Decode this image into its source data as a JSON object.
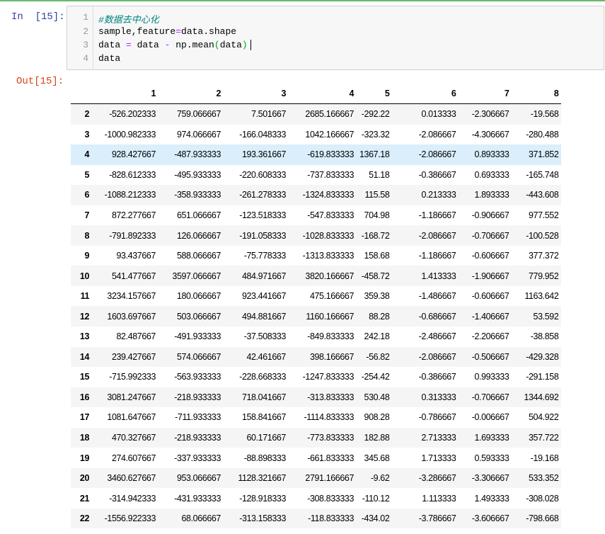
{
  "cell": {
    "in_prompt": "In  [15]:",
    "out_prompt": "Out[15]:",
    "line_numbers": [
      "1",
      "2",
      "3",
      "4"
    ],
    "code": {
      "line1_comment": "#数据去中心化",
      "line2_a": "sample,feature",
      "line2_op": "=",
      "line2_b": "data.shape",
      "line3_a": "data ",
      "line3_op1": "=",
      "line3_b": " data ",
      "line3_op2": "-",
      "line3_c": " np.mean",
      "line3_p1": "(",
      "line3_d": "data",
      "line3_p2": ")",
      "line4": "data"
    }
  },
  "table": {
    "columns": [
      "1",
      "2",
      "3",
      "4",
      "5",
      "6",
      "7",
      "8"
    ],
    "highlighted_row": "4",
    "rows": [
      {
        "index": "2",
        "values": [
          "-526.202333",
          "759.066667",
          "7.501667",
          "2685.166667",
          "-292.22",
          "0.013333",
          "-2.306667",
          "-19.568"
        ]
      },
      {
        "index": "3",
        "values": [
          "-1000.982333",
          "974.066667",
          "-166.048333",
          "1042.166667",
          "-323.32",
          "-2.086667",
          "-4.306667",
          "-280.488"
        ]
      },
      {
        "index": "4",
        "values": [
          "928.427667",
          "-487.933333",
          "193.361667",
          "-619.833333",
          "1367.18",
          "-2.086667",
          "0.893333",
          "371.852"
        ]
      },
      {
        "index": "5",
        "values": [
          "-828.612333",
          "-495.933333",
          "-220.608333",
          "-737.833333",
          "51.18",
          "-0.386667",
          "0.693333",
          "-165.748"
        ]
      },
      {
        "index": "6",
        "values": [
          "-1088.212333",
          "-358.933333",
          "-261.278333",
          "-1324.833333",
          "115.58",
          "0.213333",
          "1.893333",
          "-443.608"
        ]
      },
      {
        "index": "7",
        "values": [
          "872.277667",
          "651.066667",
          "-123.518333",
          "-547.833333",
          "704.98",
          "-1.186667",
          "-0.906667",
          "977.552"
        ]
      },
      {
        "index": "8",
        "values": [
          "-791.892333",
          "126.066667",
          "-191.058333",
          "-1028.833333",
          "-168.72",
          "-2.086667",
          "-0.706667",
          "-100.528"
        ]
      },
      {
        "index": "9",
        "values": [
          "93.437667",
          "588.066667",
          "-75.778333",
          "-1313.833333",
          "158.68",
          "-1.186667",
          "-0.606667",
          "377.372"
        ]
      },
      {
        "index": "10",
        "values": [
          "541.477667",
          "3597.066667",
          "484.971667",
          "3820.166667",
          "-458.72",
          "1.413333",
          "-1.906667",
          "779.952"
        ]
      },
      {
        "index": "11",
        "values": [
          "3234.157667",
          "180.066667",
          "923.441667",
          "475.166667",
          "359.38",
          "-1.486667",
          "-0.606667",
          "1163.642"
        ]
      },
      {
        "index": "12",
        "values": [
          "1603.697667",
          "503.066667",
          "494.881667",
          "1160.166667",
          "88.28",
          "-0.686667",
          "-1.406667",
          "53.592"
        ]
      },
      {
        "index": "13",
        "values": [
          "82.487667",
          "-491.933333",
          "-37.508333",
          "-849.833333",
          "242.18",
          "-2.486667",
          "-2.206667",
          "-38.858"
        ]
      },
      {
        "index": "14",
        "values": [
          "239.427667",
          "574.066667",
          "42.461667",
          "398.166667",
          "-56.82",
          "-2.086667",
          "-0.506667",
          "-429.328"
        ]
      },
      {
        "index": "15",
        "values": [
          "-715.992333",
          "-563.933333",
          "-228.668333",
          "-1247.833333",
          "-254.42",
          "-0.386667",
          "0.993333",
          "-291.158"
        ]
      },
      {
        "index": "16",
        "values": [
          "3081.247667",
          "-218.933333",
          "718.041667",
          "-313.833333",
          "530.48",
          "0.313333",
          "-0.706667",
          "1344.692"
        ]
      },
      {
        "index": "17",
        "values": [
          "1081.647667",
          "-711.933333",
          "158.841667",
          "-1114.833333",
          "908.28",
          "-0.786667",
          "-0.006667",
          "504.922"
        ]
      },
      {
        "index": "18",
        "values": [
          "470.327667",
          "-218.933333",
          "60.171667",
          "-773.833333",
          "182.88",
          "2.713333",
          "1.693333",
          "357.722"
        ]
      },
      {
        "index": "19",
        "values": [
          "274.607667",
          "-337.933333",
          "-88.898333",
          "-661.833333",
          "345.68",
          "1.713333",
          "0.593333",
          "-19.168"
        ]
      },
      {
        "index": "20",
        "values": [
          "3460.627667",
          "953.066667",
          "1128.321667",
          "2791.166667",
          "-9.62",
          "-3.286667",
          "-3.306667",
          "533.352"
        ]
      },
      {
        "index": "21",
        "values": [
          "-314.942333",
          "-431.933333",
          "-128.918333",
          "-308.833333",
          "-110.12",
          "1.113333",
          "1.493333",
          "-308.028"
        ]
      },
      {
        "index": "22",
        "values": [
          "-1556.922333",
          "68.066667",
          "-313.158333",
          "-118.833333",
          "-434.02",
          "-3.786667",
          "-3.606667",
          "-798.668"
        ]
      }
    ]
  }
}
